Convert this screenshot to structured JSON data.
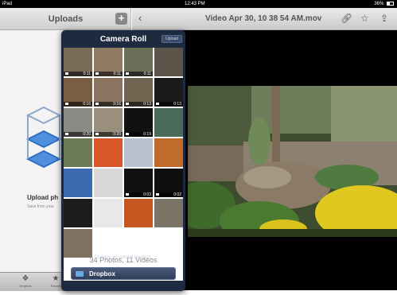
{
  "statusbar": {
    "device": "iPad",
    "time": "12:43 PM",
    "battery": "36%"
  },
  "left_panel": {
    "title": "Uploads",
    "add_icon": "plus-icon",
    "upload_title": "Upload ph",
    "upload_subtitle": "Save from your",
    "tabs": [
      {
        "label": "Dropbox",
        "icon": "dropbox-icon"
      },
      {
        "label": "Favorit",
        "icon": "star-icon"
      }
    ]
  },
  "video_nav": {
    "back_icon": "chevron-left-icon",
    "title": "Video Apr 30, 10 38 54 AM.mov",
    "icons": [
      "link-icon",
      "star-icon",
      "share-icon"
    ]
  },
  "popover": {
    "title": "Camera Roll",
    "upload_label": "Upload",
    "thumbnails": [
      {
        "color": "#7a6a58",
        "video": true,
        "duration": "0:11"
      },
      {
        "color": "#8f7b63",
        "video": true,
        "duration": "0:11"
      },
      {
        "color": "#6b6f58",
        "video": true,
        "duration": "0:11"
      },
      {
        "color": "#5c5448",
        "video": false,
        "duration": ""
      },
      {
        "color": "#7a5e42",
        "video": true,
        "duration": "0:16"
      },
      {
        "color": "#8a7460",
        "video": true,
        "duration": "0:16"
      },
      {
        "color": "#6e6450",
        "video": true,
        "duration": "0:13"
      },
      {
        "color": "#1a1a1a",
        "video": true,
        "duration": "0:13"
      },
      {
        "color": "#8c8a86",
        "video": true,
        "duration": "0:20"
      },
      {
        "color": "#9a8e7c",
        "video": true,
        "duration": "0:20"
      },
      {
        "color": "#111111",
        "video": true,
        "duration": "0:19"
      },
      {
        "color": "#4a6a5a",
        "video": false,
        "duration": ""
      },
      {
        "color": "#6c7a55",
        "video": false,
        "duration": ""
      },
      {
        "color": "#d8562a",
        "video": false,
        "duration": ""
      },
      {
        "color": "#b9c3cf",
        "video": false,
        "duration": ""
      },
      {
        "color": "#c06a2c",
        "video": false,
        "duration": ""
      },
      {
        "color": "#3a6ab0",
        "video": false,
        "duration": ""
      },
      {
        "color": "#d8d8d8",
        "video": false,
        "duration": ""
      },
      {
        "color": "#111111",
        "video": true,
        "duration": "0:03"
      },
      {
        "color": "#0f0f0f",
        "video": true,
        "duration": "0:02"
      },
      {
        "color": "#1c1c1c",
        "video": false,
        "duration": ""
      },
      {
        "color": "#e8e8e8",
        "video": false,
        "duration": ""
      },
      {
        "color": "#c8571f",
        "video": false,
        "duration": ""
      },
      {
        "color": "#7c7466",
        "video": false,
        "duration": ""
      },
      {
        "color": "#807060",
        "video": false,
        "duration": ""
      }
    ],
    "counts": "34 Photos, 11 Videos",
    "choose_text": "Choose an upload location.",
    "destination": {
      "label": "Dropbox",
      "icon": "folder-icon"
    }
  }
}
